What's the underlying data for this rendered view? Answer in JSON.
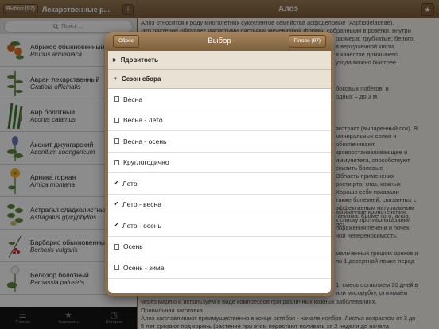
{
  "left": {
    "back_button": "Выбор (97)",
    "title": "Лекарственные р...",
    "info_label": "i",
    "search_placeholder": "Поиск ...",
    "plants": [
      {
        "name": "Абрикос обыкновенный",
        "latin": "Prunus armeniaca"
      },
      {
        "name": "Авран лекарственный",
        "latin": "Gratiola officinalis"
      },
      {
        "name": "Аир болотный",
        "latin": "Acorus calamus"
      },
      {
        "name": "Аконит джунгарский",
        "latin": "Aconitum soongaricum"
      },
      {
        "name": "Арника горная",
        "latin": "Arnica montana"
      },
      {
        "name": "Астрагал сладколистный",
        "latin": "Astragalus glycyphyllos"
      },
      {
        "name": "Барбарис обыкновенный",
        "latin": "Berberis vulgaris"
      },
      {
        "name": "Белозор болотный",
        "latin": "Parnassia palustris"
      }
    ],
    "tabs": [
      {
        "label": "Список",
        "icon": "list-icon"
      },
      {
        "label": "Фавориты",
        "icon": "star-icon"
      },
      {
        "label": "История",
        "icon": "clock-icon"
      }
    ]
  },
  "right": {
    "title": "Алоэ",
    "star_label": "★",
    "article_lines": [
      "Алоэ относится к роду многолетних суккулентов семейства асфоделовые (Asphodelaceae).",
      "Это растение обладает мясистыми листьями мечевидной формы, собранными в розетки, внутри",
      "размера; трубчатые; белого,",
      "в верхушечной кисти.",
      "в качестве домашнего",
      "ухода можно быстрее",
      "боковых побегов, в",
      "одных – до 3 м.",
      "экстракт (выпаренный сок). В",
      "минеральных солей и",
      "обеспечивают",
      "кровоостанавливающее и",
      "иммунитета, способствуют",
      "снизить болевые",
      "Область применения",
      "рости рта, глаз, кожных",
      "Хорошо себя показали",
      "также болезней, связанных с",
      "эффективным натуральным",
      "ганизма. Кроме того, алоэ",
      "нет.",
      "вызванные кровотечения:",
      "к списку противопоказаний",
      "поражения печени и почек,",
      "ной непереносимость.",
      "мельченных грецких орехов и",
      "по 1 десертной ложке перед",
      "1, смесь оставляем 30 дней в",
      "или мясорубку, отжимаем",
      "через марлю и используем в виде компрессов при различных кожных заболеваниях.",
      "Правильная заготовка",
      "Алоэ заготавливают преимущественно в конце октября - начале ноября. Листья возрастом от 3 до",
      "5 лет срезают под корень (растение при этом перестают поливать за 2 недели до начала"
    ]
  },
  "popover": {
    "title": "Выбор",
    "reset_label": "Сброс",
    "done_label": "Готово (97)",
    "groups": [
      {
        "label": "Ядовитость",
        "expanded": false,
        "arrow": "▶"
      },
      {
        "label": "Сезон сбора",
        "expanded": true,
        "arrow": "▼"
      }
    ],
    "options": [
      {
        "label": "Весна",
        "checked": false
      },
      {
        "label": "Весна - лето",
        "checked": false
      },
      {
        "label": "Весна - осень",
        "checked": false
      },
      {
        "label": "Круглогодично",
        "checked": false
      },
      {
        "label": "Лето",
        "checked": true
      },
      {
        "label": "Лето - весна",
        "checked": true
      },
      {
        "label": "Лето - осень",
        "checked": true
      },
      {
        "label": "Осень",
        "checked": false
      },
      {
        "label": "Осень - зима",
        "checked": false
      }
    ]
  },
  "colors": {
    "header_brown": "#8a6f4c",
    "group_bg": "#e9e2d4",
    "tabbar_bg": "#141414"
  }
}
